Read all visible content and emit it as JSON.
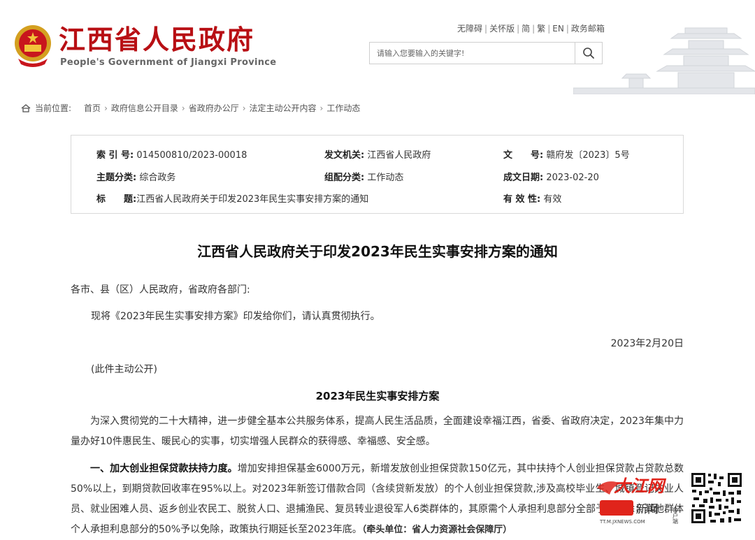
{
  "header": {
    "site_title": "江西省人民政府",
    "site_subtitle": "People's Government of Jiangxi Province",
    "top_links": [
      "无障碍",
      "关怀版",
      "简",
      "繁",
      "EN",
      "政务邮箱"
    ],
    "search": {
      "placeholder": "请输入您要输入的关键字!"
    }
  },
  "breadcrumb": {
    "label": "当前位置:",
    "items": [
      "首页",
      "政府信息公开目录",
      "省政府办公厅",
      "法定主动公开内容",
      "工作动态"
    ]
  },
  "meta": {
    "index_label": "索 引 号:",
    "index_value": "014500810/2023-00018",
    "issuer_label": "发文机关:",
    "issuer_value": "江西省人民政府",
    "docno_label": "文　　号:",
    "docno_value": "赣府发〔2023〕5号",
    "topic_label": "主题分类:",
    "topic_value": "综合政务",
    "category_label": "组配分类:",
    "category_value": "工作动态",
    "date_label": "成文日期:",
    "date_value": "2023-02-20",
    "title_label": "标　　题:",
    "title_value": "江西省人民政府关于印发2023年民生实事安排方案的通知",
    "validity_label": "有 效 性:",
    "validity_value": "有效"
  },
  "document": {
    "title": "江西省人民政府关于印发2023年民生实事安排方案的通知",
    "addressee": "各市、县（区）人民政府，省政府各部门:",
    "intro": "现将《2023年民生实事安排方案》印发给你们，请认真贯彻执行。",
    "date": "2023年2月20日",
    "public_note": "(此件主动公开)",
    "section_title": "2023年民生实事安排方案",
    "para1": "为深入贯彻党的二十大精神，进一步健全基本公共服务体系，提高人民生活品质，全面建设幸福江西，省委、省政府决定，2023年集中力量办好10件惠民生、暖民心的实事，切实增强人民群众的获得感、幸福感、安全感。",
    "item1_lead": "一、加大创业担保贷款扶持力度。",
    "item1_body": "增加安排担保基金6000万元，新增发放创业担保贷款150亿元，其中扶持个人创业担保贷款占贷款总数50%以上，到期贷款回收率在95%以上。对2023年新签订借款合同（含续贷新发放）的个人创业担保贷款,涉及高校毕业生、城镇登记失业人员、就业困难人员、返乡创业农民工、脱贫人口、退捕渔民、复员转业退役军人6类群体的，其原需个人承担利息部分全部予以免除；其他群体个人承担利息部分的50%予以免除，政策执行期延长至2023年底。",
    "item1_owner": "（牵头单位：省人力资源社会保障厅）"
  },
  "watermark": {
    "brand": "大江网",
    "news": "新闻",
    "url": "TT.M.JXNEWS.COM",
    "client": "客户端"
  }
}
